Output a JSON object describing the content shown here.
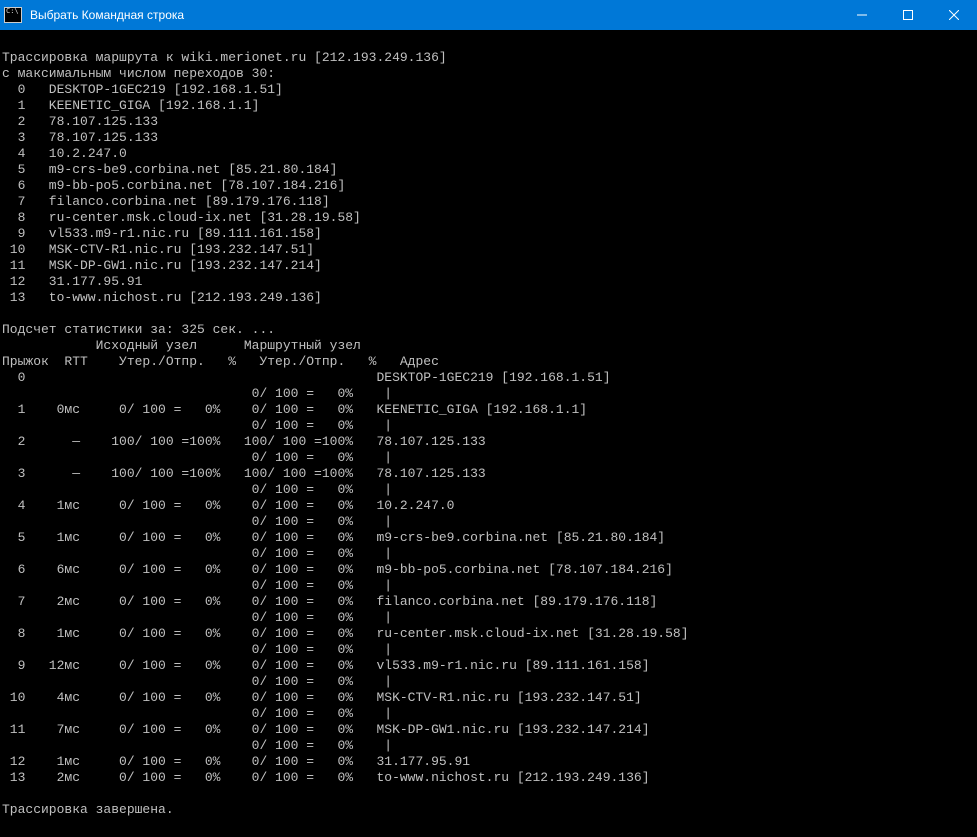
{
  "window": {
    "title": "Выбрать Командная строка"
  },
  "trace_header": {
    "line1": "Трассировка маршрута к wiki.merionet.ru [212.193.249.136]",
    "line2": "с максимальным числом переходов 30:"
  },
  "hops": [
    {
      "n": "0",
      "text": "DESKTOP-1GEC219 [192.168.1.51]"
    },
    {
      "n": "1",
      "text": "KEENETIC_GIGA [192.168.1.1]"
    },
    {
      "n": "2",
      "text": "78.107.125.133"
    },
    {
      "n": "3",
      "text": "78.107.125.133"
    },
    {
      "n": "4",
      "text": "10.2.247.0"
    },
    {
      "n": "5",
      "text": "m9-crs-be9.corbina.net [85.21.80.184]"
    },
    {
      "n": "6",
      "text": "m9-bb-po5.corbina.net [78.107.184.216]"
    },
    {
      "n": "7",
      "text": "filanco.corbina.net [89.179.176.118]"
    },
    {
      "n": "8",
      "text": "ru-center.msk.cloud-ix.net [31.28.19.58]"
    },
    {
      "n": "9",
      "text": "vl533.m9-r1.nic.ru [89.111.161.158]"
    },
    {
      "n": "10",
      "text": "MSK-CTV-R1.nic.ru [193.232.147.51]"
    },
    {
      "n": "11",
      "text": "MSK-DP-GW1.nic.ru [193.232.147.214]"
    },
    {
      "n": "12",
      "text": "31.177.95.91"
    },
    {
      "n": "13",
      "text": "to-www.nichost.ru [212.193.249.136]"
    }
  ],
  "stats_header": {
    "line1": "Подсчет статистики за: 325 сек. ...",
    "line2": "            Исходный узел      Маршрутный узел",
    "line3": "Прыжок  RTT    Утер./Отпр.   %   Утер./Отпр.   %   Адрес"
  },
  "stats": [
    {
      "hop": "0",
      "rtt": "",
      "src": "",
      "rte": "",
      "addr": "DESKTOP-1GEC219 [192.168.1.51]",
      "link": "0/ 100 =   0%"
    },
    {
      "hop": "1",
      "rtt": "0мс",
      "src": "0/ 100 =   0%",
      "rte": "0/ 100 =   0%",
      "addr": "KEENETIC_GIGA [192.168.1.1]",
      "link": "0/ 100 =   0%"
    },
    {
      "hop": "2",
      "rtt": "—",
      "src": "100/ 100 =100%",
      "rte": "100/ 100 =100%",
      "addr": "78.107.125.133",
      "link": "0/ 100 =   0%"
    },
    {
      "hop": "3",
      "rtt": "—",
      "src": "100/ 100 =100%",
      "rte": "100/ 100 =100%",
      "addr": "78.107.125.133",
      "link": "0/ 100 =   0%"
    },
    {
      "hop": "4",
      "rtt": "1мс",
      "src": "0/ 100 =   0%",
      "rte": "0/ 100 =   0%",
      "addr": "10.2.247.0",
      "link": "0/ 100 =   0%"
    },
    {
      "hop": "5",
      "rtt": "1мс",
      "src": "0/ 100 =   0%",
      "rte": "0/ 100 =   0%",
      "addr": "m9-crs-be9.corbina.net [85.21.80.184]",
      "link": "0/ 100 =   0%"
    },
    {
      "hop": "6",
      "rtt": "6мс",
      "src": "0/ 100 =   0%",
      "rte": "0/ 100 =   0%",
      "addr": "m9-bb-po5.corbina.net [78.107.184.216]",
      "link": "0/ 100 =   0%"
    },
    {
      "hop": "7",
      "rtt": "2мс",
      "src": "0/ 100 =   0%",
      "rte": "0/ 100 =   0%",
      "addr": "filanco.corbina.net [89.179.176.118]",
      "link": "0/ 100 =   0%"
    },
    {
      "hop": "8",
      "rtt": "1мс",
      "src": "0/ 100 =   0%",
      "rte": "0/ 100 =   0%",
      "addr": "ru-center.msk.cloud-ix.net [31.28.19.58]",
      "link": "0/ 100 =   0%"
    },
    {
      "hop": "9",
      "rtt": "12мс",
      "src": "0/ 100 =   0%",
      "rte": "0/ 100 =   0%",
      "addr": "vl533.m9-r1.nic.ru [89.111.161.158]",
      "link": "0/ 100 =   0%"
    },
    {
      "hop": "10",
      "rtt": "4мс",
      "src": "0/ 100 =   0%",
      "rte": "0/ 100 =   0%",
      "addr": "MSK-CTV-R1.nic.ru [193.232.147.51]",
      "link": "0/ 100 =   0%"
    },
    {
      "hop": "11",
      "rtt": "7мс",
      "src": "0/ 100 =   0%",
      "rte": "0/ 100 =   0%",
      "addr": "MSK-DP-GW1.nic.ru [193.232.147.214]",
      "link": "0/ 100 =   0%"
    },
    {
      "hop": "12",
      "rtt": "1мс",
      "src": "0/ 100 =   0%",
      "rte": "0/ 100 =   0%",
      "addr": "31.177.95.91",
      "link": ""
    },
    {
      "hop": "13",
      "rtt": "2мс",
      "src": "0/ 100 =   0%",
      "rte": "0/ 100 =   0%",
      "addr": "to-www.nichost.ru [212.193.249.136]",
      "link": ""
    }
  ],
  "footer": "Трассировка завершена."
}
